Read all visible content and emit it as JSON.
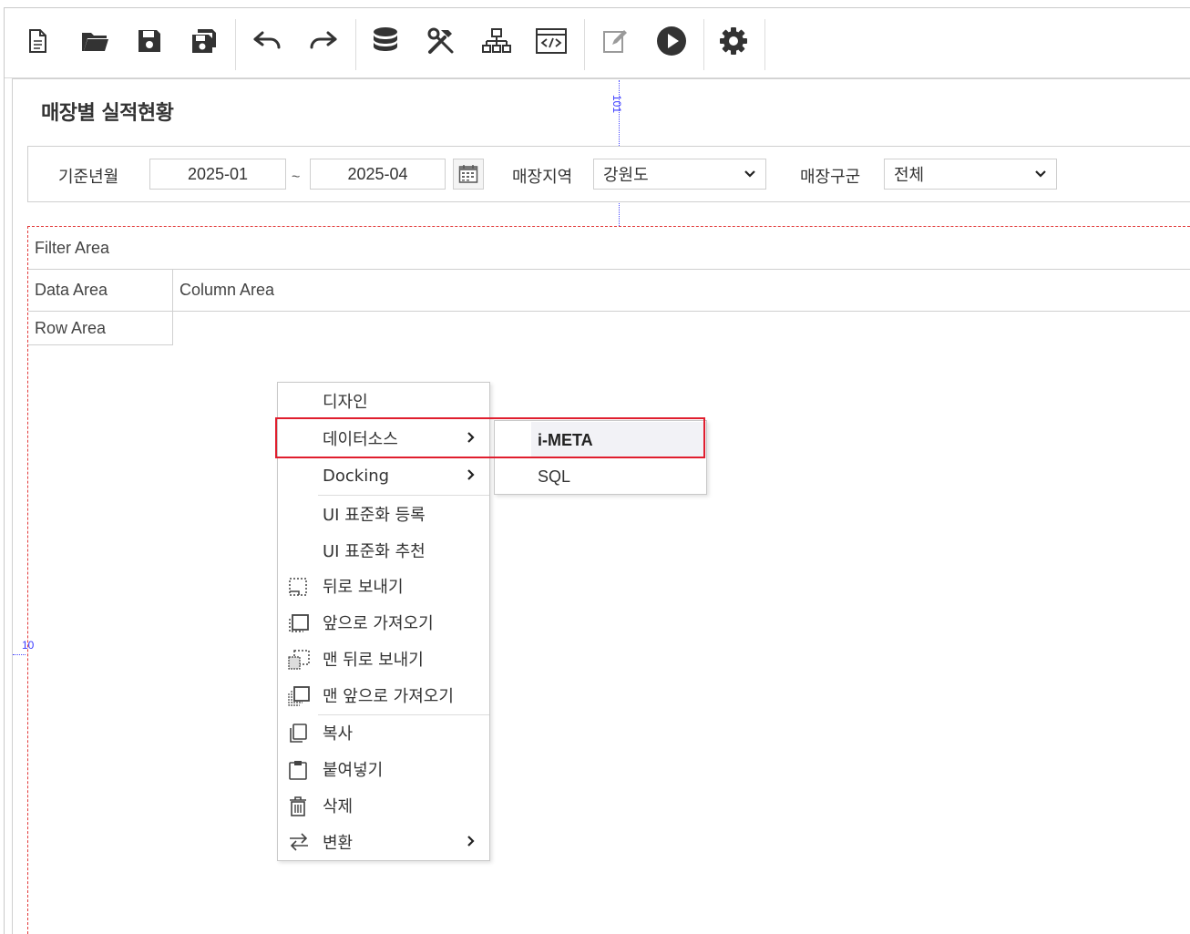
{
  "page": {
    "title": "매장별 실적현황"
  },
  "guides": {
    "vertical_label": "101",
    "horizontal_label": "10"
  },
  "toolbar": {
    "items": [
      {
        "name": "new-icon"
      },
      {
        "name": "open-folder-icon"
      },
      {
        "name": "save-icon"
      },
      {
        "name": "save-all-icon"
      },
      {
        "name": "undo-icon"
      },
      {
        "name": "redo-icon"
      },
      {
        "name": "database-icon"
      },
      {
        "name": "tools-icon"
      },
      {
        "name": "hierarchy-icon"
      },
      {
        "name": "code-icon"
      },
      {
        "name": "edit-icon"
      },
      {
        "name": "play-icon"
      },
      {
        "name": "gear-icon"
      }
    ]
  },
  "search": {
    "period_label": "기준년월",
    "from": "2025-01",
    "tilde": "~",
    "to": "2025-04",
    "region_label": "매장지역",
    "region_value": "강원도",
    "type_label": "매장구군",
    "type_value": "전체"
  },
  "pivot": {
    "filter_area": "Filter Area",
    "data_area": "Data Area",
    "column_area": "Column Area",
    "row_area": "Row Area"
  },
  "context_menu": {
    "design": "디자인",
    "datasource": "데이터소스",
    "docking": "Docking",
    "ui_register": "UI 표준화 등록",
    "ui_recommend": "UI 표준화 추천",
    "send_backward": "뒤로 보내기",
    "bring_forward": "앞으로 가져오기",
    "send_to_back": "맨 뒤로 보내기",
    "bring_to_front": "맨 앞으로 가져오기",
    "copy": "복사",
    "paste": "붙여넣기",
    "delete": "삭제",
    "convert": "변환"
  },
  "submenu": {
    "imeta": "i-META",
    "sql": "SQL"
  },
  "colors": {
    "highlight": "#e01e2e",
    "guide": "#4a4aff",
    "pivot_border": "#e23a3a"
  }
}
